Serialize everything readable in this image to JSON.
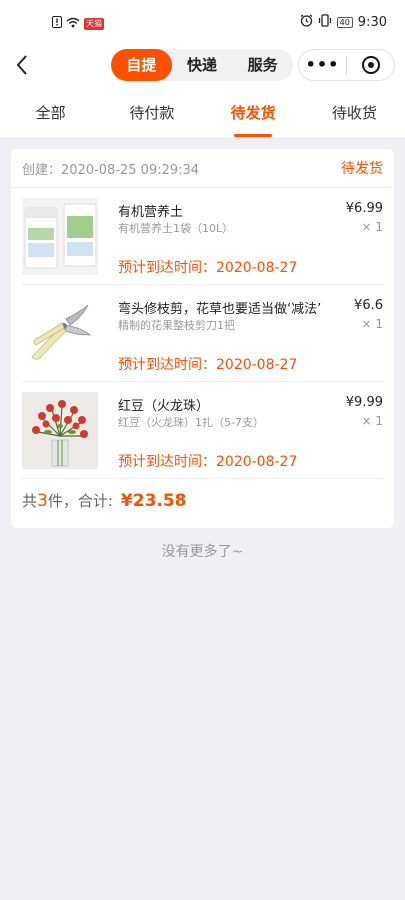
{
  "status_bar": {
    "badge": "天猫",
    "time": "9:30",
    "battery": "40"
  },
  "nav": {
    "back_icon": "chevron-left-icon",
    "segments": [
      {
        "label": "自提",
        "active": true
      },
      {
        "label": "快递",
        "active": false
      },
      {
        "label": "服务",
        "active": false
      }
    ],
    "more_label": "•••"
  },
  "tabs": [
    {
      "label": "全部",
      "active": false
    },
    {
      "label": "待付款",
      "active": false
    },
    {
      "label": "待发货",
      "active": true
    },
    {
      "label": "待收货",
      "active": false
    }
  ],
  "order": {
    "created": "创建：2020-08-25 09:29:34",
    "status": "待发货",
    "items": [
      {
        "name": "有机营养土",
        "spec": "有机营养土1袋（10L）",
        "price": "¥6.99",
        "qty": "× 1",
        "eta": "预计到达时间：2020-08-27"
      },
      {
        "name": "弯头修枝剪，花草也要适当做‘减法’",
        "spec": "精制的花果整枝剪刀1把",
        "price": "¥6.6",
        "qty": "× 1",
        "eta": "预计到达时间：2020-08-27"
      },
      {
        "name": "红豆（火龙珠）",
        "spec": "红豆（火龙珠）1扎（5-7支）",
        "price": "¥9.99",
        "qty": "× 1",
        "eta": "预计到达时间：2020-08-27"
      }
    ],
    "footer": {
      "prefix": "共",
      "count": "3",
      "suffix": "件，合计:",
      "total": "¥23.58"
    }
  },
  "no_more": "没有更多了~",
  "colors": {
    "accent": "#ff5000",
    "background": "#efeff4"
  }
}
